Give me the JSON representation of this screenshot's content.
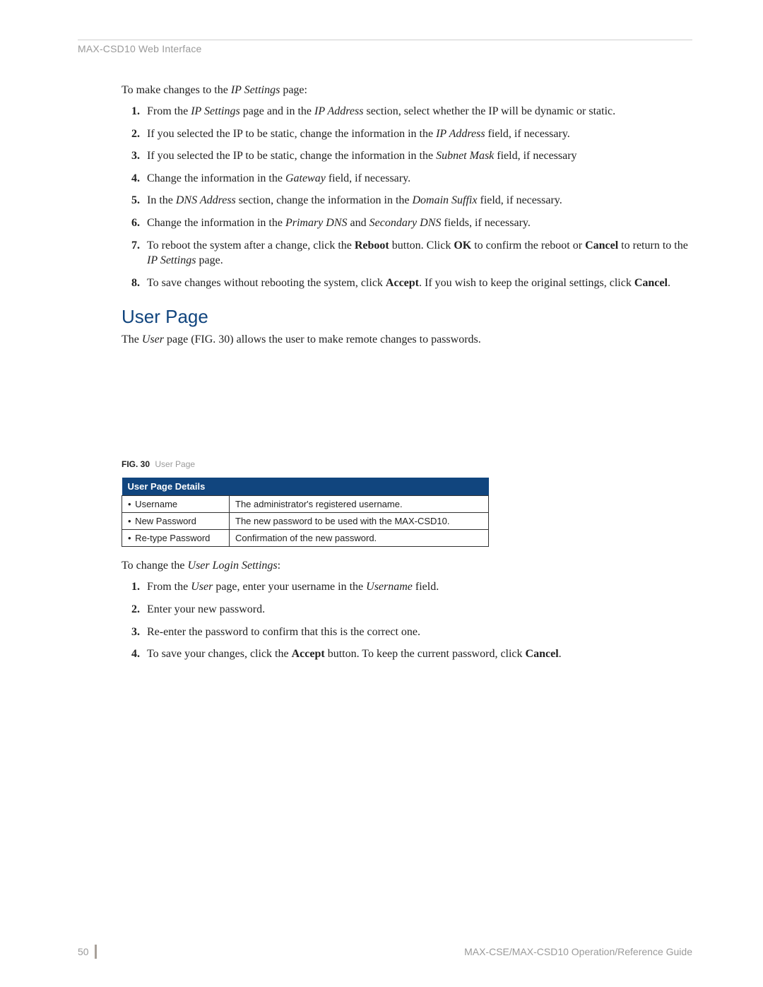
{
  "header": {
    "breadcrumb": "MAX-CSD10 Web Interface"
  },
  "intro1_parts": [
    "To make changes to the ",
    "IP Settings",
    " page:"
  ],
  "steps1": [
    [
      [
        "t",
        "From the "
      ],
      [
        "i",
        "IP Settings"
      ],
      [
        "t",
        " page and in the "
      ],
      [
        "i",
        "IP Address"
      ],
      [
        "t",
        " section, select whether the IP will be dynamic or static."
      ]
    ],
    [
      [
        "t",
        "If you selected the IP to be static, change the information in the "
      ],
      [
        "i",
        "IP Address"
      ],
      [
        "t",
        " field, if necessary."
      ]
    ],
    [
      [
        "t",
        "If you selected the IP to be static, change the information in the "
      ],
      [
        "i",
        "Subnet Mask"
      ],
      [
        "t",
        " field, if necessary"
      ]
    ],
    [
      [
        "t",
        "Change the information in the "
      ],
      [
        "i",
        "Gateway"
      ],
      [
        "t",
        " field, if necessary."
      ]
    ],
    [
      [
        "t",
        "In the "
      ],
      [
        "i",
        "DNS Address"
      ],
      [
        "t",
        " section, change the information in the "
      ],
      [
        "i",
        "Domain Suffix"
      ],
      [
        "t",
        " field, if necessary."
      ]
    ],
    [
      [
        "t",
        "Change the information in the "
      ],
      [
        "i",
        "Primary DNS"
      ],
      [
        "t",
        " and "
      ],
      [
        "i",
        "Secondary DNS"
      ],
      [
        "t",
        " fields, if necessary."
      ]
    ],
    [
      [
        "t",
        "To reboot the system after a change, click the "
      ],
      [
        "b",
        "Reboot"
      ],
      [
        "t",
        " button. Click "
      ],
      [
        "b",
        "OK"
      ],
      [
        "t",
        " to confirm the reboot or "
      ],
      [
        "b",
        "Cancel"
      ],
      [
        "t",
        " to return to the "
      ],
      [
        "i",
        "IP Settings"
      ],
      [
        "t",
        " page."
      ]
    ],
    [
      [
        "t",
        "To save changes without rebooting the system, click "
      ],
      [
        "b",
        "Accept"
      ],
      [
        "t",
        ". If you wish to keep the original settings, click "
      ],
      [
        "b",
        "Cancel"
      ],
      [
        "t",
        "."
      ]
    ]
  ],
  "heading": "User Page",
  "user_intro_parts": [
    [
      "t",
      "The "
    ],
    [
      "i",
      "User"
    ],
    [
      "t",
      " page (FIG. 30) allows the user to make remote changes to passwords."
    ]
  ],
  "figure": {
    "label": "FIG. 30",
    "title": "User Page"
  },
  "table": {
    "header": "User Page Details",
    "rows": [
      {
        "key": "Username",
        "desc": "The administrator's registered username."
      },
      {
        "key": "New Password",
        "desc": "The new password to be used with the MAX-CSD10."
      },
      {
        "key": "Re-type Password",
        "desc": "Confirmation of the new password."
      }
    ]
  },
  "intro2_parts": [
    [
      "t",
      "To change the "
    ],
    [
      "i",
      "User Login Settings"
    ],
    [
      "t",
      ":"
    ]
  ],
  "steps2": [
    [
      [
        "t",
        "From the "
      ],
      [
        "i",
        "User"
      ],
      [
        "t",
        " page, enter your username in the "
      ],
      [
        "i",
        "Username"
      ],
      [
        "t",
        " field."
      ]
    ],
    [
      [
        "t",
        "Enter your new password."
      ]
    ],
    [
      [
        "t",
        "Re-enter the password to confirm that this is the correct one."
      ]
    ],
    [
      [
        "t",
        "To save your changes, click the "
      ],
      [
        "b",
        "Accept"
      ],
      [
        "t",
        " button. To keep the current password, click "
      ],
      [
        "b",
        "Cancel"
      ],
      [
        "t",
        "."
      ]
    ]
  ],
  "footer": {
    "page": "50",
    "guide": "MAX-CSE/MAX-CSD10 Operation/Reference Guide"
  }
}
